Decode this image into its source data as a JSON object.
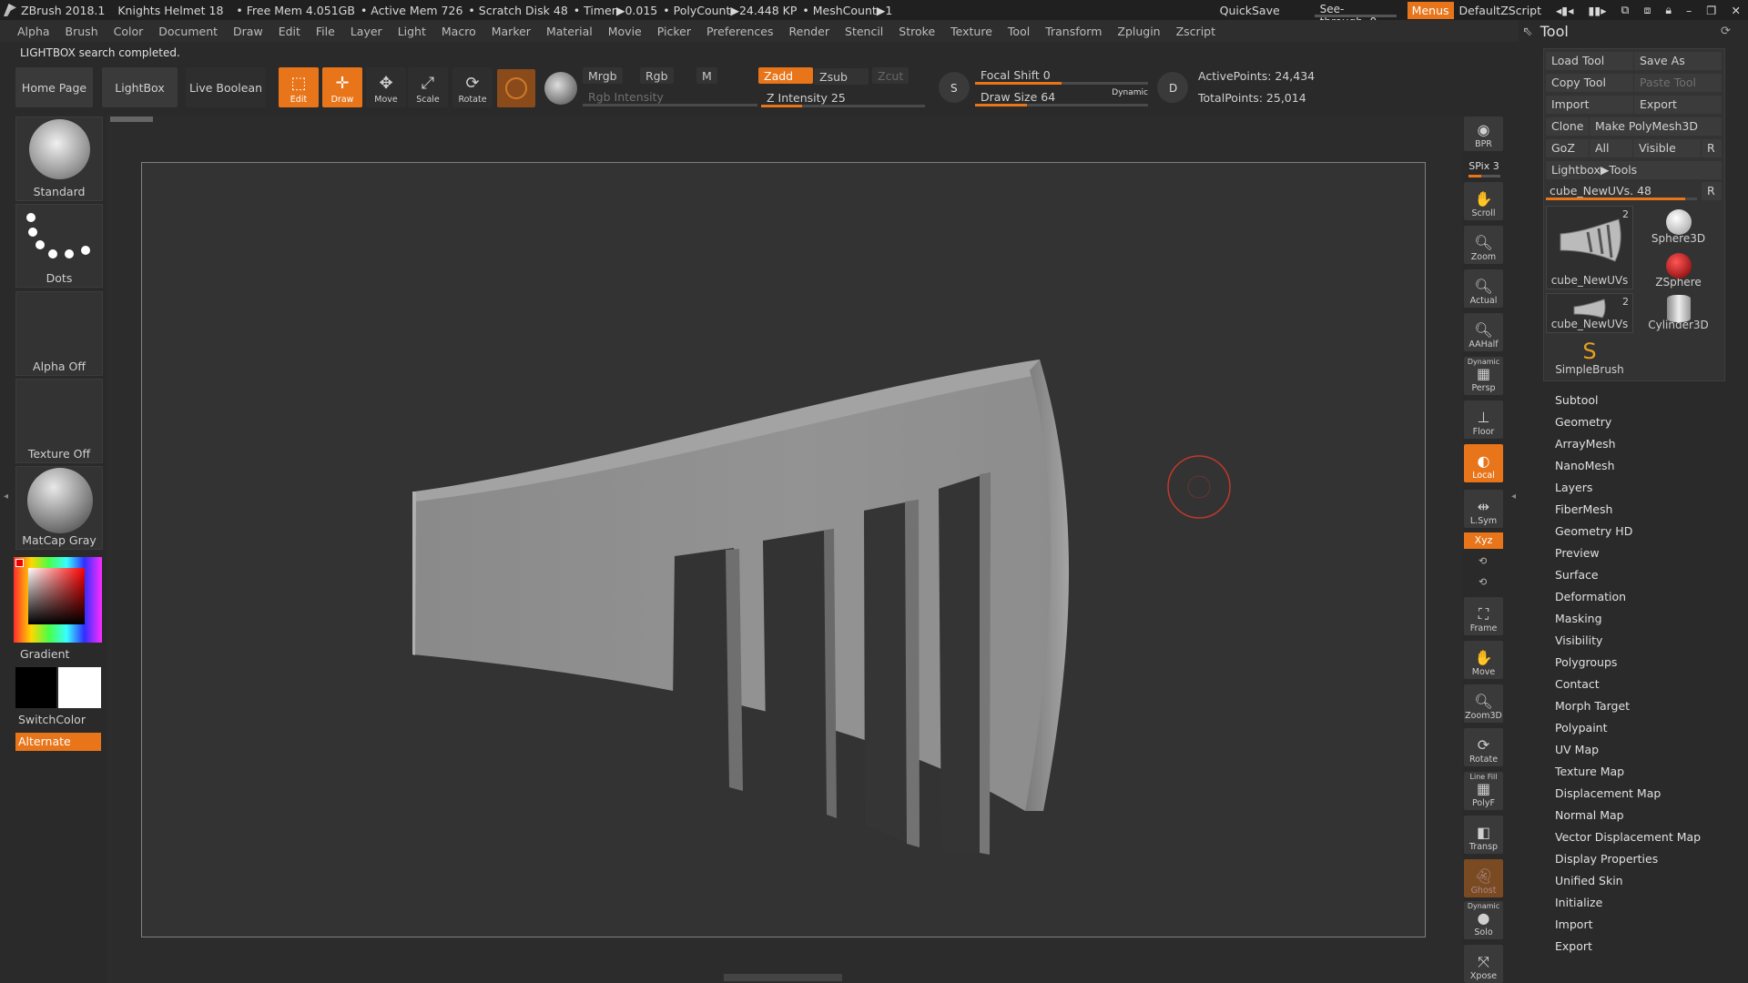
{
  "titlebar": {
    "app": "ZBrush 2018.1",
    "project": "Knights Helmet 18",
    "free_mem": "• Free Mem 4.051GB",
    "active_mem": "• Active Mem 726",
    "scratch": "• Scratch Disk 48",
    "timer": "• Timer▶0.015",
    "polycount": "• PolyCount▶24.448 KP",
    "meshcount": "• MeshCount▶1",
    "quicksave": "QuickSave",
    "see_through_label": "See-through",
    "see_through_value": "0",
    "see_through_level": 0,
    "menus": "Menus",
    "script": "DefaultZScript"
  },
  "menubar": [
    "Alpha",
    "Brush",
    "Color",
    "Document",
    "Draw",
    "Edit",
    "File",
    "Layer",
    "Light",
    "Macro",
    "Marker",
    "Material",
    "Movie",
    "Picker",
    "Preferences",
    "Render",
    "Stencil",
    "Stroke",
    "Texture",
    "Tool",
    "Transform",
    "Zplugin",
    "Zscript"
  ],
  "status": "LIGHTBOX search completed.",
  "shelf": {
    "home": "Home Page",
    "lightbox": "LightBox",
    "live_boolean": "Live Boolean",
    "edit": "Edit",
    "draw": "Draw",
    "move": "Move",
    "scale": "Scale",
    "rotate": "Rotate",
    "mrgb": "Mrgb",
    "rgb": "Rgb",
    "m": "M",
    "zadd": "Zadd",
    "zsub": "Zsub",
    "zcut": "Zcut",
    "rgb_intensity": "Rgb Intensity",
    "z_intensity": "Z Intensity 25",
    "z_intensity_level": 0.25,
    "focal_shift": "Focal Shift 0",
    "focal_level": 0.5,
    "draw_size": "Draw Size 64",
    "draw_size_level": 0.3,
    "dynamic": "Dynamic",
    "active_points": "ActivePoints: 24,434",
    "total_points": "TotalPoints: 25,014"
  },
  "left_tray": {
    "brush": "Standard",
    "stroke": "Dots",
    "alpha": "Alpha Off",
    "texture": "Texture Off",
    "material": "MatCap Gray",
    "gradient": "Gradient",
    "switch_color": "SwitchColor",
    "alternate": "Alternate"
  },
  "right_shelf": {
    "bpr": "BPR",
    "spix": "SPix 3",
    "scroll": "Scroll",
    "zoom": "Zoom",
    "actual": "Actual",
    "aahalf": "AAHalf",
    "dynamic": "Dynamic",
    "persp": "Persp",
    "floor": "Floor",
    "local": "Local",
    "lsym": "L.Sym",
    "xyz": "Xyz",
    "frame": "Frame",
    "move": "Move",
    "zoom3d": "Zoom3D",
    "rotate": "Rotate",
    "line_fill": "Line Fill",
    "polyf": "PolyF",
    "transp": "Transp",
    "ghost": "Ghost",
    "solo_dyn": "Dynamic",
    "solo": "Solo",
    "xpose": "Xpose"
  },
  "tool_palette": {
    "title": "Tool",
    "load_tool": "Load Tool",
    "save_as": "Save As",
    "copy_tool": "Copy Tool",
    "paste_tool": "Paste Tool",
    "import": "Import",
    "export": "Export",
    "clone": "Clone",
    "make_polymesh": "Make PolyMesh3D",
    "goz": "GoZ",
    "all": "All",
    "visible": "Visible",
    "r": "R",
    "lightbox_tools": "Lightbox▶Tools",
    "current_tool": "cube_NewUVs. 48",
    "current_tool_level": 0.92,
    "thumbs": {
      "t1_name": "cube_NewUVs",
      "t1_count": "2",
      "t2_name": "Sphere3D",
      "t3_name": "ZSphere",
      "t4_name": "cube_NewUVs",
      "t4_count": "2",
      "t5_name": "Cylinder3D",
      "t6_name": "SimpleBrush"
    },
    "sections": [
      "Subtool",
      "Geometry",
      "ArrayMesh",
      "NanoMesh",
      "Layers",
      "FiberMesh",
      "Geometry HD",
      "Preview",
      "Surface",
      "Deformation",
      "Masking",
      "Visibility",
      "Polygroups",
      "Contact",
      "Morph Target",
      "Polypaint",
      "UV Map",
      "Texture Map",
      "Displacement Map",
      "Normal Map",
      "Vector Displacement Map",
      "Display Properties",
      "Unified Skin",
      "Initialize",
      "Import",
      "Export"
    ]
  },
  "colors": {
    "accent": "#e8751a",
    "background": "#2a2a2a",
    "cursor_ring": "#c0392b"
  }
}
